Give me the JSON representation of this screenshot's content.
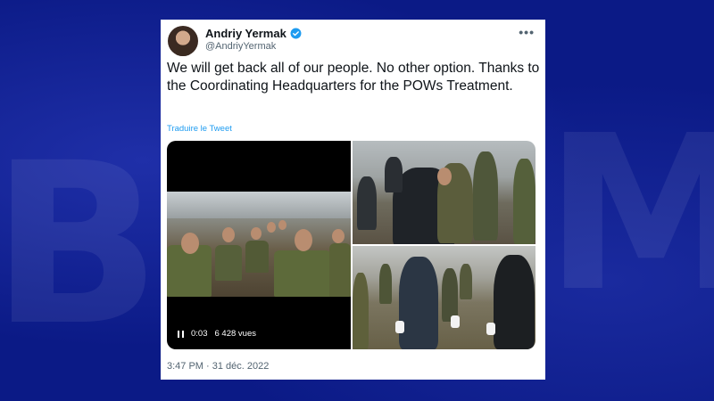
{
  "tweet": {
    "author_name": "Andriy Yermak",
    "author_handle": "@AndriyYermak",
    "text": "We will get back all of our people. No other option. Thanks to the Coordinating Headquarters for the POWs Treatment.",
    "translate_label": "Traduire le Tweet",
    "more_icon": "more-icon",
    "verified_icon": "verified-badge-icon",
    "video": {
      "time": "0:03",
      "views": "6 428 vues",
      "icon": "pause-icon"
    },
    "timestamp": "3:47 PM · 31 déc. 2022"
  },
  "colors": {
    "background": "#0b1a86",
    "card": "#ffffff",
    "text": "#0f1419",
    "secondary": "#536471",
    "link": "#1d9bf0"
  }
}
